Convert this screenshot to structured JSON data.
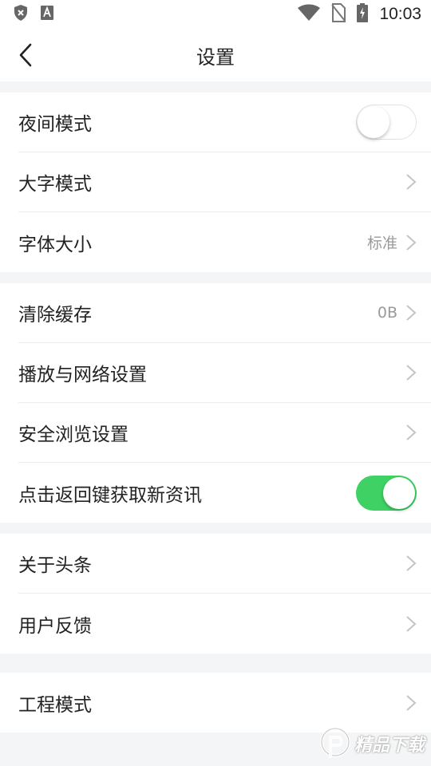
{
  "status_bar": {
    "time": "10:03",
    "icons": [
      "shield-x-icon",
      "a-notification-icon",
      "wifi-icon",
      "no-sim-icon",
      "battery-charging-icon"
    ]
  },
  "header": {
    "title": "设置",
    "back_icon": "chevron-left-icon"
  },
  "groups": [
    {
      "items": [
        {
          "label": "夜间模式",
          "type": "toggle",
          "on": false
        },
        {
          "label": "大字模式",
          "type": "chevron"
        },
        {
          "label": "字体大小",
          "type": "chevron",
          "value": "标准"
        }
      ]
    },
    {
      "items": [
        {
          "label": "清除缓存",
          "type": "chevron",
          "value": "0B"
        },
        {
          "label": "播放与网络设置",
          "type": "chevron"
        },
        {
          "label": "安全浏览设置",
          "type": "chevron"
        },
        {
          "label": "点击返回键获取新资讯",
          "type": "toggle",
          "on": true
        }
      ]
    },
    {
      "items": [
        {
          "label": "关于头条",
          "type": "chevron"
        },
        {
          "label": "用户反馈",
          "type": "chevron"
        }
      ]
    },
    {
      "items": [
        {
          "label": "工程模式",
          "type": "chevron"
        }
      ]
    }
  ],
  "watermark": {
    "text": "精品下载"
  },
  "colors": {
    "toggle_on": "#3fd163",
    "background": "#f4f5f6",
    "secondary_text": "#9a9a9a"
  }
}
